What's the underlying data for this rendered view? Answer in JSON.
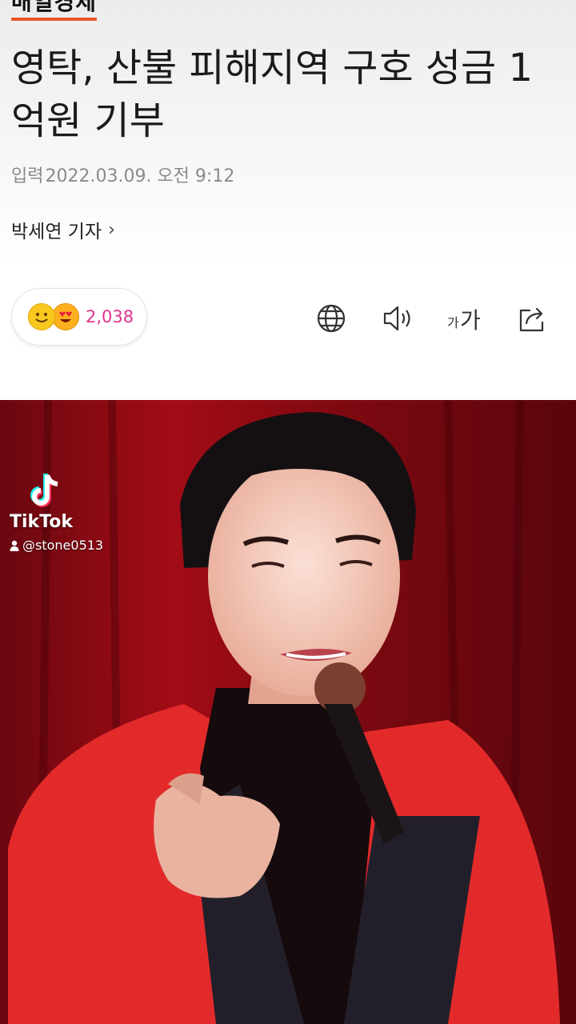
{
  "article": {
    "section": "매일경제",
    "headline": "영탁, 산불 피해지역 구호 성금 1억원 기부",
    "timestamp_label": "입력",
    "timestamp": "2022.03.09. 오전 9:12",
    "reporter": "박세연 기자",
    "reporter_chevron": "›"
  },
  "reactions": {
    "icons": [
      "smile-emoji-icon",
      "heart-eyes-emoji-icon"
    ],
    "count": "2,038",
    "count_color": "#e0338c"
  },
  "toolbar": {
    "icons": [
      "globe-icon",
      "speaker-icon",
      "font-size-icon",
      "share-icon"
    ],
    "font_size_label": "가가"
  },
  "overlay": {
    "brand": "TikTok",
    "handle": "@stone0513"
  },
  "colors": {
    "accent": "#e8562a",
    "photo_background": "#8a0b12"
  }
}
